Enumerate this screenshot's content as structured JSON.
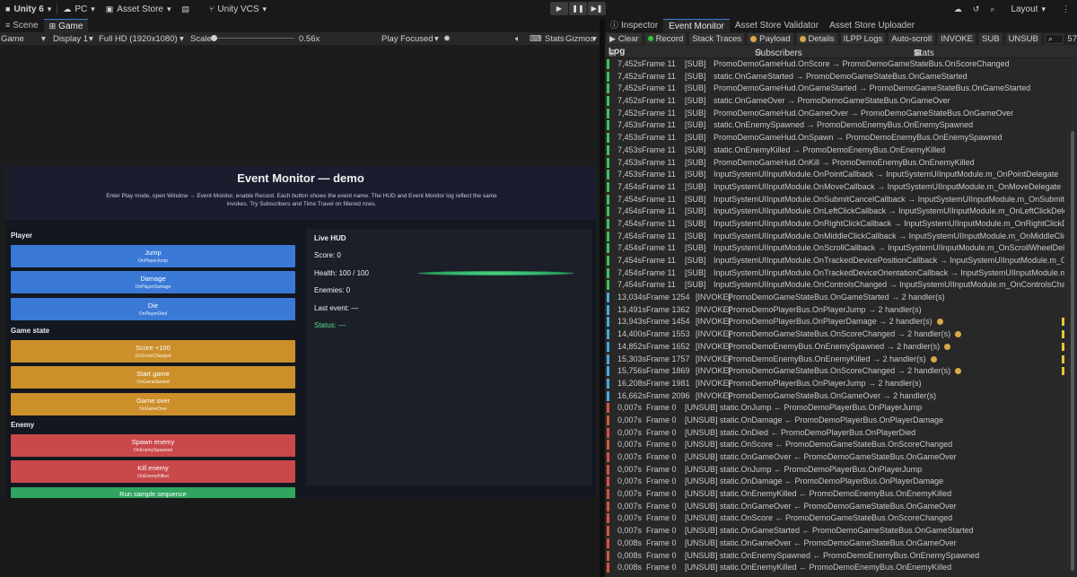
{
  "topbar": {
    "app": "Unity 6",
    "platform": "PC",
    "asset_store": "Asset Store",
    "vcs": "Unity VCS",
    "layout": "Layout"
  },
  "left_tabs": {
    "scene": "Scene",
    "game": "Game"
  },
  "gamebar": {
    "mode": "Game",
    "display": "Display 1",
    "resolution": "Full HD (1920x1080)",
    "scale_label": "Scale",
    "scale_value": "0.56x",
    "play_focused": "Play Focused",
    "stats": "Stats",
    "gizmos": "Gizmos"
  },
  "game": {
    "title": "Event Monitor — demo",
    "description": "Enter Play mode, open Window → Event Monitor, enable Record. Each button shows the event name. The HUD and Event Monitor log reflect the same invokes. Try Subscribers and Time Travel on filtered rows.",
    "sections": {
      "player": "Player",
      "game_state": "Game state",
      "enemy": "Enemy"
    },
    "buttons": [
      {
        "label": "Jump",
        "event": "OnPlayerJump",
        "color": "#3a79d6"
      },
      {
        "label": "Damage",
        "event": "OnPlayerDamage",
        "color": "#3a79d6"
      },
      {
        "label": "Die",
        "event": "OnPlayerDied",
        "color": "#3a79d6"
      },
      {
        "label": "Score +100",
        "event": "OnScoreChanged",
        "color": "#cc8f2a"
      },
      {
        "label": "Start game",
        "event": "OnGameStarted",
        "color": "#cc8f2a"
      },
      {
        "label": "Game over",
        "event": "OnGameOver",
        "color": "#cc8f2a"
      },
      {
        "label": "Spawn enemy",
        "event": "OnEnemySpawned",
        "color": "#c9494a"
      },
      {
        "label": "Kill enemy",
        "event": "OnEnemyKilled",
        "color": "#c9494a"
      }
    ],
    "run_sample": "Run sample sequence",
    "hud": {
      "title": "Live HUD",
      "score": "Score: 0",
      "health": "Health: 100 / 100",
      "health_fraction": 1.0,
      "enemies": "Enemies: 0",
      "last_event": "Last event: —",
      "status": "Status: —"
    }
  },
  "right_tabs": {
    "inspector": "Inspector",
    "event_monitor": "Event Monitor",
    "validator": "Asset Store Validator",
    "uploader": "Asset Store Uploader"
  },
  "toolbar": {
    "clear": "Clear",
    "record": "Record",
    "stack_traces": "Stack Traces",
    "payload": "Payload",
    "details": "Details",
    "ilpp_logs": "ILPP Logs",
    "auto_scroll": "Auto-scroll",
    "invoke": "INVOKE",
    "sub": "SUB",
    "unsub": "UNSUB",
    "search_suffix": "57"
  },
  "columns": {
    "log": "Log",
    "subscribers": "Subscribers",
    "stats": "Stats"
  },
  "colors": {
    "sub": "#3fc35a",
    "invoke": "#4aa8e0",
    "unsub": "#d9533f"
  },
  "log": [
    {
      "time": "7,452s",
      "frame": "Frame 11",
      "kind": "[SUB]",
      "message": "PromoDemoGameHud.OnScore → PromoDemoGameStateBus.OnScoreChanged"
    },
    {
      "time": "7,452s",
      "frame": "Frame 11",
      "kind": "[SUB]",
      "message": "static.OnGameStarted → PromoDemoGameStateBus.OnGameStarted"
    },
    {
      "time": "7,452s",
      "frame": "Frame 11",
      "kind": "[SUB]",
      "message": "PromoDemoGameHud.OnGameStarted → PromoDemoGameStateBus.OnGameStarted"
    },
    {
      "time": "7,452s",
      "frame": "Frame 11",
      "kind": "[SUB]",
      "message": "static.OnGameOver → PromoDemoGameStateBus.OnGameOver"
    },
    {
      "time": "7,452s",
      "frame": "Frame 11",
      "kind": "[SUB]",
      "message": "PromoDemoGameHud.OnGameOver → PromoDemoGameStateBus.OnGameOver"
    },
    {
      "time": "7,453s",
      "frame": "Frame 11",
      "kind": "[SUB]",
      "message": "static.OnEnemySpawned → PromoDemoEnemyBus.OnEnemySpawned"
    },
    {
      "time": "7,453s",
      "frame": "Frame 11",
      "kind": "[SUB]",
      "message": "PromoDemoGameHud.OnSpawn → PromoDemoEnemyBus.OnEnemySpawned"
    },
    {
      "time": "7,453s",
      "frame": "Frame 11",
      "kind": "[SUB]",
      "message": "static.OnEnemyKilled → PromoDemoEnemyBus.OnEnemyKilled"
    },
    {
      "time": "7,453s",
      "frame": "Frame 11",
      "kind": "[SUB]",
      "message": "PromoDemoGameHud.OnKill → PromoDemoEnemyBus.OnEnemyKilled"
    },
    {
      "time": "7,453s",
      "frame": "Frame 11",
      "kind": "[SUB]",
      "message": "InputSystemUIInputModule.OnPointCallback → InputSystemUIInputModule.m_OnPointDelegate"
    },
    {
      "time": "7,454s",
      "frame": "Frame 11",
      "kind": "[SUB]",
      "message": "InputSystemUIInputModule.OnMoveCallback → InputSystemUIInputModule.m_OnMoveDelegate"
    },
    {
      "time": "7,454s",
      "frame": "Frame 11",
      "kind": "[SUB]",
      "message": "InputSystemUIInputModule.OnSubmitCancelCallback → InputSystemUIInputModule.m_OnSubmitCancelDelegate"
    },
    {
      "time": "7,454s",
      "frame": "Frame 11",
      "kind": "[SUB]",
      "message": "InputSystemUIInputModule.OnLeftClickCallback → InputSystemUIInputModule.m_OnLeftClickDelegate"
    },
    {
      "time": "7,454s",
      "frame": "Frame 11",
      "kind": "[SUB]",
      "message": "InputSystemUIInputModule.OnRightClickCallback → InputSystemUIInputModule.m_OnRightClickDelegate"
    },
    {
      "time": "7,454s",
      "frame": "Frame 11",
      "kind": "[SUB]",
      "message": "InputSystemUIInputModule.OnMiddleClickCallback → InputSystemUIInputModule.m_OnMiddleClickDelegate"
    },
    {
      "time": "7,454s",
      "frame": "Frame 11",
      "kind": "[SUB]",
      "message": "InputSystemUIInputModule.OnScrollCallback → InputSystemUIInputModule.m_OnScrollWheelDelegate"
    },
    {
      "time": "7,454s",
      "frame": "Frame 11",
      "kind": "[SUB]",
      "message": "InputSystemUIInputModule.OnTrackedDevicePositionCallback → InputSystemUIInputModule.m_OnTrackedDe"
    },
    {
      "time": "7,454s",
      "frame": "Frame 11",
      "kind": "[SUB]",
      "message": "InputSystemUIInputModule.OnTrackedDeviceOrientationCallback → InputSystemUIInputModule.m_OnTrack"
    },
    {
      "time": "7,454s",
      "frame": "Frame 11",
      "kind": "[SUB]",
      "message": "InputSystemUIInputModule.OnControlsChanged → InputSystemUIInputModule.m_OnControlsChangedDelega"
    },
    {
      "time": "13,034s",
      "frame": "Frame 1254",
      "kind": "[INVOKE]",
      "message": "PromoDemoGameStateBus.OnGameStarted → 2 handler(s)"
    },
    {
      "time": "13,491s",
      "frame": "Frame 1362",
      "kind": "[INVOKE]",
      "message": "PromoDemoPlayerBus.OnPlayerJump → 2 handler(s)"
    },
    {
      "time": "13,943s",
      "frame": "Frame 1454",
      "kind": "[INVOKE]",
      "message": "PromoDemoPlayerBus.OnPlayerDamage → 2 handler(s)",
      "payload": true,
      "flag": true
    },
    {
      "time": "14,400s",
      "frame": "Frame 1553",
      "kind": "[INVOKE]",
      "message": "PromoDemoGameStateBus.OnScoreChanged → 2 handler(s)",
      "payload": true,
      "flag": true
    },
    {
      "time": "14,852s",
      "frame": "Frame 1652",
      "kind": "[INVOKE]",
      "message": "PromoDemoEnemyBus.OnEnemySpawned → 2 handler(s)",
      "payload": true,
      "flag": true
    },
    {
      "time": "15,303s",
      "frame": "Frame 1757",
      "kind": "[INVOKE]",
      "message": "PromoDemoEnemyBus.OnEnemyKilled → 2 handler(s)",
      "payload": true,
      "flag": true
    },
    {
      "time": "15,756s",
      "frame": "Frame 1869",
      "kind": "[INVOKE]",
      "message": "PromoDemoGameStateBus.OnScoreChanged → 2 handler(s)",
      "payload": true,
      "flag": true
    },
    {
      "time": "16,208s",
      "frame": "Frame 1981",
      "kind": "[INVOKE]",
      "message": "PromoDemoPlayerBus.OnPlayerJump → 2 handler(s)"
    },
    {
      "time": "16,662s",
      "frame": "Frame 2096",
      "kind": "[INVOKE]",
      "message": "PromoDemoGameStateBus.OnGameOver → 2 handler(s)"
    },
    {
      "time": "0,007s",
      "frame": "Frame 0",
      "kind": "[UNSUB]",
      "message": "static.OnJump ← PromoDemoPlayerBus.OnPlayerJump"
    },
    {
      "time": "0,007s",
      "frame": "Frame 0",
      "kind": "[UNSUB]",
      "message": "static.OnDamage ← PromoDemoPlayerBus.OnPlayerDamage"
    },
    {
      "time": "0,007s",
      "frame": "Frame 0",
      "kind": "[UNSUB]",
      "message": "static.OnDied ← PromoDemoPlayerBus.OnPlayerDied"
    },
    {
      "time": "0,007s",
      "frame": "Frame 0",
      "kind": "[UNSUB]",
      "message": "static.OnScore ← PromoDemoGameStateBus.OnScoreChanged"
    },
    {
      "time": "0,007s",
      "frame": "Frame 0",
      "kind": "[UNSUB]",
      "message": "static.OnGameOver ← PromoDemoGameStateBus.OnGameOver"
    },
    {
      "time": "0,007s",
      "frame": "Frame 0",
      "kind": "[UNSUB]",
      "message": "static.OnJump ← PromoDemoPlayerBus.OnPlayerJump"
    },
    {
      "time": "0,007s",
      "frame": "Frame 0",
      "kind": "[UNSUB]",
      "message": "static.OnDamage ← PromoDemoPlayerBus.OnPlayerDamage"
    },
    {
      "time": "0,007s",
      "frame": "Frame 0",
      "kind": "[UNSUB]",
      "message": "static.OnEnemyKilled ← PromoDemoEnemyBus.OnEnemyKilled"
    },
    {
      "time": "0,007s",
      "frame": "Frame 0",
      "kind": "[UNSUB]",
      "message": "static.OnGameOver ← PromoDemoGameStateBus.OnGameOver"
    },
    {
      "time": "0,007s",
      "frame": "Frame 0",
      "kind": "[UNSUB]",
      "message": "static.OnScore ← PromoDemoGameStateBus.OnScoreChanged"
    },
    {
      "time": "0,007s",
      "frame": "Frame 0",
      "kind": "[UNSUB]",
      "message": "static.OnGameStarted ← PromoDemoGameStateBus.OnGameStarted"
    },
    {
      "time": "0,008s",
      "frame": "Frame 0",
      "kind": "[UNSUB]",
      "message": "static.OnGameOver ← PromoDemoGameStateBus.OnGameOver"
    },
    {
      "time": "0,008s",
      "frame": "Frame 0",
      "kind": "[UNSUB]",
      "message": "static.OnEnemySpawned ← PromoDemoEnemyBus.OnEnemySpawned"
    },
    {
      "time": "0,008s",
      "frame": "Frame 0",
      "kind": "[UNSUB]",
      "message": "static.OnEnemyKilled ← PromoDemoEnemyBus.OnEnemyKilled"
    }
  ]
}
